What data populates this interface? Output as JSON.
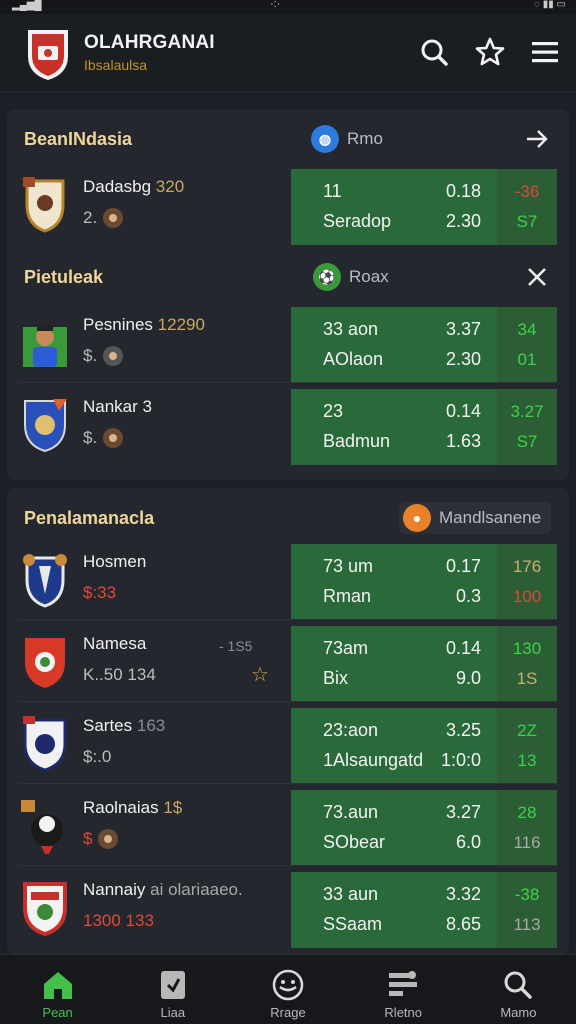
{
  "header": {
    "title": "OLAHRGANAI",
    "subtitle": "Ibsalaulsa",
    "icons": [
      "search-icon",
      "star-icon",
      "menu-icon"
    ]
  },
  "colors": {
    "accent_green": "#43c04a",
    "odds_green": "#2a6a3a",
    "section_title": "#eed69a",
    "up": "#3ed24a",
    "down": "#e3453a",
    "neutral": "#c9b070"
  },
  "sections": [
    {
      "title": "BeanINdasia",
      "pill": {
        "label": "Rmo",
        "icon": "globe-icon",
        "color": "#2e7be0"
      },
      "action": "arrow-right-icon",
      "rows": [
        {
          "name": "Dadasbg",
          "name_extra": "320",
          "sub": "2.",
          "line1": "11",
          "val1": "0.18",
          "line2": "Seradop",
          "val2": "2.30",
          "side1": "-36",
          "side2": "S7",
          "side1_color": "#e3453a",
          "side2_color": "#3ed24a"
        }
      ]
    },
    {
      "title": "Pietuleak",
      "pill": {
        "label": "Roax",
        "icon": "football-icon",
        "color": "#3a9a3a"
      },
      "action": "close-icon",
      "rows": [
        {
          "name": "Pesnines",
          "name_extra": "12290",
          "sub": "$.",
          "line1": "33 aon",
          "val1": "3.37",
          "line2": "AOlaon",
          "val2": "2.30",
          "side1": "34",
          "side2": "01",
          "side1_color": "#3ed24a",
          "side2_color": "#3ed24a"
        },
        {
          "name": "Nankar",
          "name_extra": "3",
          "sub": "$.",
          "line1": "23",
          "val1": "0.14",
          "line2": "Badmun",
          "val2": "1.63",
          "side1": "3.27",
          "side2": "S7",
          "side1_color": "#3ed24a",
          "side2_color": "#3ed24a"
        }
      ]
    },
    {
      "title": "Penalamanacla",
      "pill": {
        "label": "Mandlsanene",
        "icon": "coin-icon",
        "color": "#e8822a"
      },
      "rows": [
        {
          "name": "Hosmen",
          "name_extra": "",
          "sub": "$:33",
          "line1": "73 um",
          "val1": "0.17",
          "line2": "Rman",
          "val2": "0.3",
          "side1": "176",
          "side2": "100",
          "side1_color": "#c9b070",
          "side2_color": "#e3453a"
        },
        {
          "name": "Namesa",
          "name_extra": "",
          "note": "- 1S5",
          "sub": "K..50 134",
          "line1": "73am",
          "val1": "0.14",
          "line2": "Bix",
          "val2": "9.0",
          "side1": "130",
          "side2": "1S",
          "side1_color": "#3ed24a",
          "side2_color": "#c9b070"
        },
        {
          "name": "Sartes",
          "name_extra": "163",
          "sub": "$:.0",
          "line1": "23:aon",
          "val1": "3.25",
          "line2": "1Alsaungatd",
          "val2": "1:0:0",
          "side1": "2Z",
          "side2": "13",
          "side1_color": "#3ed24a",
          "side2_color": "#3ed24a"
        },
        {
          "name": "Raolnaias",
          "name_extra": "1$",
          "sub": "$",
          "line1": "73.aun",
          "val1": "3.27",
          "line2": "SObear",
          "val2": "6.0",
          "side1": "28",
          "side2": "116",
          "side1_color": "#3ed24a",
          "side2_color": "#a8a8a8"
        },
        {
          "name": "Nannaiy",
          "name_extra": "ai olariaaeo.",
          "sub": "1300 133",
          "line1": "33 aun",
          "val1": "3.32",
          "line2": "SSaam",
          "val2": "8.65",
          "side1": "-38",
          "side2": "113",
          "side1_color": "#3ed24a",
          "side2_color": "#a8a8a8"
        }
      ]
    }
  ],
  "nav": [
    {
      "label": "Pean",
      "icon": "home-icon",
      "active": true
    },
    {
      "label": "Liaa",
      "icon": "ticket-icon",
      "active": false
    },
    {
      "label": "Rrage",
      "icon": "soccer-ball-icon",
      "active": false
    },
    {
      "label": "Rletno",
      "icon": "stats-icon",
      "active": false
    },
    {
      "label": "Mamo",
      "icon": "search-icon",
      "active": false
    }
  ]
}
